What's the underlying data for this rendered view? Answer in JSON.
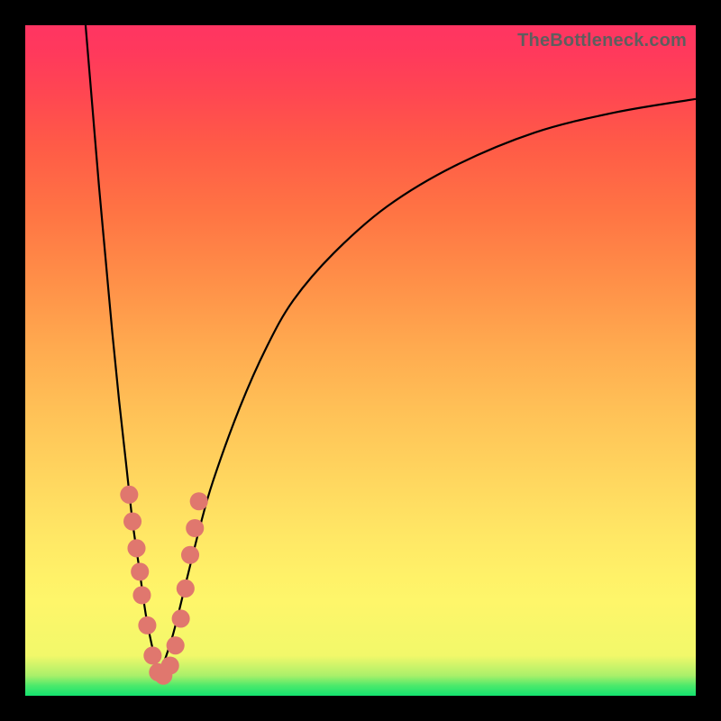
{
  "attribution": "TheBottleneck.com",
  "colors": {
    "frame": "#000000",
    "green": "#14e36f",
    "yellow": "#fef66a",
    "orange": "#ff8f48",
    "red": "#ff4652",
    "pink": "#ff3562",
    "bead": "#e0776e",
    "curve": "#000000"
  },
  "chart_data": {
    "type": "line",
    "title": "",
    "xlabel": "",
    "ylabel": "",
    "xlim": [
      0,
      100
    ],
    "ylim": [
      0,
      100
    ],
    "grid": false,
    "legend": null,
    "note": "No numeric axes are rendered; x/y are in percent of plot area. y=0 is green (good / no bottleneck), y=100 is red (severe bottleneck). Two curve arms meet near x~20 forming a V; values are estimated from pixel geometry.",
    "series": [
      {
        "name": "left_arm",
        "x": [
          9,
          10,
          11,
          12,
          13,
          14,
          15,
          16,
          17,
          18,
          19,
          20
        ],
        "y": [
          100,
          88,
          76,
          65,
          54,
          44,
          35,
          26,
          19,
          12,
          7,
          3
        ]
      },
      {
        "name": "right_arm",
        "x": [
          20,
          22,
          24,
          26,
          28,
          32,
          36,
          40,
          46,
          54,
          64,
          76,
          88,
          100
        ],
        "y": [
          3,
          9,
          17,
          25,
          32,
          43,
          52,
          59,
          66,
          73,
          79,
          84,
          87,
          89
        ]
      }
    ],
    "beads": {
      "note": "Highlighted points (pink dots) clustered near the V bottom on both arms; coordinates in percent of plot area.",
      "points": [
        {
          "x": 15.5,
          "y": 30
        },
        {
          "x": 16.0,
          "y": 26
        },
        {
          "x": 16.6,
          "y": 22
        },
        {
          "x": 17.1,
          "y": 18.5
        },
        {
          "x": 17.4,
          "y": 15
        },
        {
          "x": 18.2,
          "y": 10.5
        },
        {
          "x": 19.0,
          "y": 6
        },
        {
          "x": 19.8,
          "y": 3.5
        },
        {
          "x": 20.6,
          "y": 3.0
        },
        {
          "x": 21.6,
          "y": 4.5
        },
        {
          "x": 22.4,
          "y": 7.5
        },
        {
          "x": 23.2,
          "y": 11.5
        },
        {
          "x": 23.9,
          "y": 16
        },
        {
          "x": 24.6,
          "y": 21
        },
        {
          "x": 25.3,
          "y": 25
        },
        {
          "x": 25.9,
          "y": 29
        }
      ],
      "radius_pct": 1.35
    }
  }
}
